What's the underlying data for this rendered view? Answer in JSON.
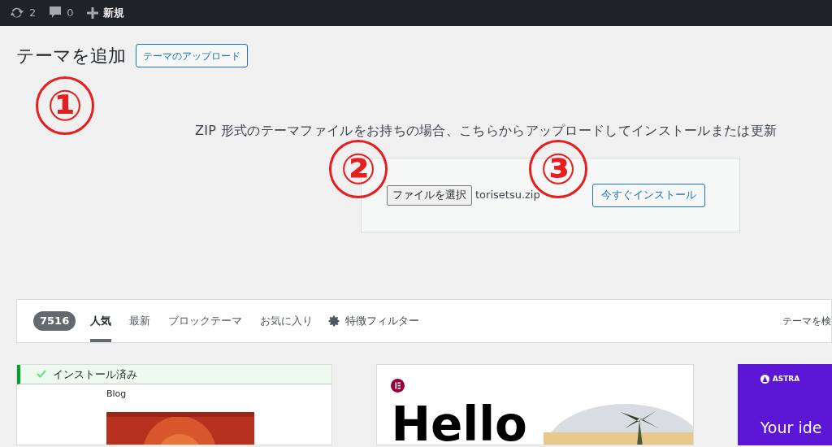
{
  "admin_bar": {
    "items": [
      {
        "kind": "updates",
        "label": "2"
      },
      {
        "kind": "comments",
        "label": "0"
      },
      {
        "kind": "new",
        "label": "新規"
      }
    ]
  },
  "heading": "テーマを追加",
  "upload_button": "テーマのアップロード",
  "annotations": [
    "①",
    "②",
    "③"
  ],
  "upload": {
    "description": "ZIP 形式のテーマファイルをお持ちの場合、こちらからアップロードしてインストールまたは更新",
    "file_button": "ファイルを選択",
    "file_name": "torisetsu.zip",
    "install_button": "今すぐインストール"
  },
  "filter_bar": {
    "count": "7516",
    "tabs": [
      {
        "label": "人気",
        "selected": true
      },
      {
        "label": "最新",
        "selected": false
      },
      {
        "label": "ブロックテーマ",
        "selected": false
      },
      {
        "label": "お気に入り",
        "selected": false
      }
    ],
    "feature_filter": "特徴フィルター",
    "search_label": "テーマを検"
  },
  "themes": [
    {
      "kind": "installed",
      "notice": "インストール済み",
      "title": "Blog"
    },
    {
      "kind": "hello",
      "title": "Hello"
    },
    {
      "kind": "astra",
      "brand": "ASTRA",
      "tagline": "Your ide"
    }
  ]
}
